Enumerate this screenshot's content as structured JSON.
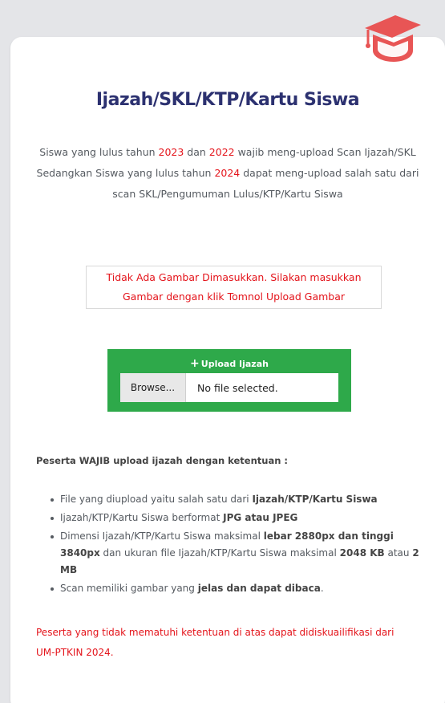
{
  "card": {
    "title": "Ijazah/SKL/KTP/Kartu Siswa",
    "cap_icon_color": "#e85555"
  },
  "description": {
    "p1": "Siswa yang lulus tahun ",
    "y1": "2023",
    "p2": " dan ",
    "y2": "2022",
    "p3": " wajib meng-upload Scan Ijazah/SKL Sedangkan Siswa yang lulus tahun ",
    "y3": "2024",
    "p4": " dapat meng-upload salah satu dari scan SKL/Pengumuman Lulus/KTP/Kartu Siswa"
  },
  "alert": {
    "text": "Tidak Ada Gambar Dimasukkan. Silakan masukkan Gambar dengan klik Tomnol Upload Gambar"
  },
  "upload": {
    "label": "Upload Ijazah",
    "plus": "+",
    "browse_label": "Browse...",
    "file_status": "No file selected."
  },
  "requirements": {
    "heading": "Peserta WAJIB upload ijazah dengan ketentuan :",
    "r1_a": "File yang diupload yaitu salah satu dari ",
    "r1_b": "Ijazah/KTP/Kartu Siswa",
    "r2_a": "Ijazah/KTP/Kartu Siswa berformat ",
    "r2_b": "JPG atau JPEG",
    "r3_a": "Dimensi Ijazah/KTP/Kartu Siswa maksimal ",
    "r3_b": "lebar 2880px dan tinggi 3840px",
    "r3_c": " dan ukuran file Ijazah/KTP/Kartu Siswa maksimal ",
    "r3_d": "2048 KB",
    "r3_e": " atau ",
    "r3_f": "2 MB",
    "r4_a": "Scan memiliki gambar yang ",
    "r4_b": "jelas dan dapat dibaca",
    "r4_c": "."
  },
  "warning": {
    "text": "Peserta yang tidak mematuhi ketentuan di atas dapat didiskuailifikasi dari UM-PTKIN 2024."
  },
  "colors": {
    "accent_red": "#e4141b",
    "title_navy": "#2c3170",
    "upload_green": "#2ea94a"
  }
}
